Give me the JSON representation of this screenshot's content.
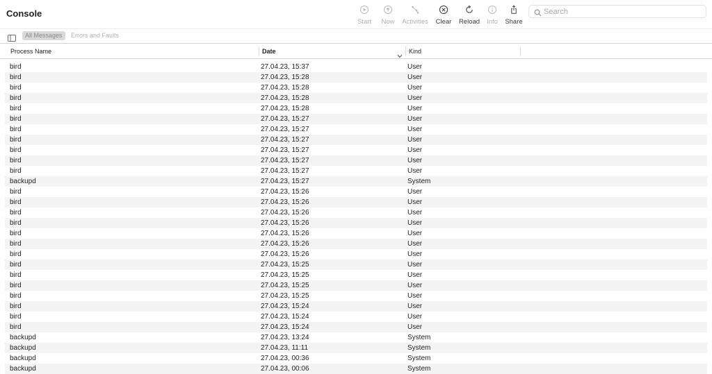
{
  "window": {
    "title": "Console"
  },
  "toolbar": {
    "start": {
      "label": "Start",
      "icon": "play-circle-icon",
      "enabled": false
    },
    "now": {
      "label": "Now",
      "icon": "arrow-up-circle-icon",
      "enabled": false
    },
    "activities": {
      "label": "Activities",
      "icon": "activities-icon",
      "enabled": false
    },
    "clear": {
      "label": "Clear",
      "icon": "x-circle-icon",
      "enabled": true
    },
    "reload": {
      "label": "Reload",
      "icon": "reload-icon",
      "enabled": true
    },
    "info": {
      "label": "Info",
      "icon": "info-circle-icon",
      "enabled": false
    },
    "share": {
      "label": "Share",
      "icon": "share-icon",
      "enabled": true
    }
  },
  "search": {
    "placeholder": "Search",
    "value": ""
  },
  "filters": {
    "all_messages": "All Messages",
    "errors_and_faults": "Errors and Faults",
    "selected": "All Messages"
  },
  "columns": {
    "process": "Process Name",
    "date": "Date",
    "kind": "Kind",
    "sort": "Date descending"
  },
  "rows": [
    {
      "process": "bird",
      "date": "27.04.23, 15:37",
      "kind": "User"
    },
    {
      "process": "bird",
      "date": "27.04.23, 15:28",
      "kind": "User"
    },
    {
      "process": "bird",
      "date": "27.04.23, 15:28",
      "kind": "User"
    },
    {
      "process": "bird",
      "date": "27.04.23, 15:28",
      "kind": "User"
    },
    {
      "process": "bird",
      "date": "27.04.23, 15:28",
      "kind": "User"
    },
    {
      "process": "bird",
      "date": "27.04.23, 15:27",
      "kind": "User"
    },
    {
      "process": "bird",
      "date": "27.04.23, 15:27",
      "kind": "User"
    },
    {
      "process": "bird",
      "date": "27.04.23, 15:27",
      "kind": "User"
    },
    {
      "process": "bird",
      "date": "27.04.23, 15:27",
      "kind": "User"
    },
    {
      "process": "bird",
      "date": "27.04.23, 15:27",
      "kind": "User"
    },
    {
      "process": "bird",
      "date": "27.04.23, 15:27",
      "kind": "User"
    },
    {
      "process": "backupd",
      "date": "27.04.23, 15:27",
      "kind": "System"
    },
    {
      "process": "bird",
      "date": "27.04.23, 15:26",
      "kind": "User"
    },
    {
      "process": "bird",
      "date": "27.04.23, 15:26",
      "kind": "User"
    },
    {
      "process": "bird",
      "date": "27.04.23, 15:26",
      "kind": "User"
    },
    {
      "process": "bird",
      "date": "27.04.23, 15:26",
      "kind": "User"
    },
    {
      "process": "bird",
      "date": "27.04.23, 15:26",
      "kind": "User"
    },
    {
      "process": "bird",
      "date": "27.04.23, 15:26",
      "kind": "User"
    },
    {
      "process": "bird",
      "date": "27.04.23, 15:26",
      "kind": "User"
    },
    {
      "process": "bird",
      "date": "27.04.23, 15:25",
      "kind": "User"
    },
    {
      "process": "bird",
      "date": "27.04.23, 15:25",
      "kind": "User"
    },
    {
      "process": "bird",
      "date": "27.04.23, 15:25",
      "kind": "User"
    },
    {
      "process": "bird",
      "date": "27.04.23, 15:25",
      "kind": "User"
    },
    {
      "process": "bird",
      "date": "27.04.23, 15:24",
      "kind": "User"
    },
    {
      "process": "bird",
      "date": "27.04.23, 15:24",
      "kind": "User"
    },
    {
      "process": "bird",
      "date": "27.04.23, 15:24",
      "kind": "User"
    },
    {
      "process": "backupd",
      "date": "27.04.23, 13:24",
      "kind": "System"
    },
    {
      "process": "backupd",
      "date": "27.04.23, 11:11",
      "kind": "System"
    },
    {
      "process": "backupd",
      "date": "27.04.23, 00:36",
      "kind": "System"
    },
    {
      "process": "backupd",
      "date": "27.04.23, 00:06",
      "kind": "System"
    }
  ]
}
